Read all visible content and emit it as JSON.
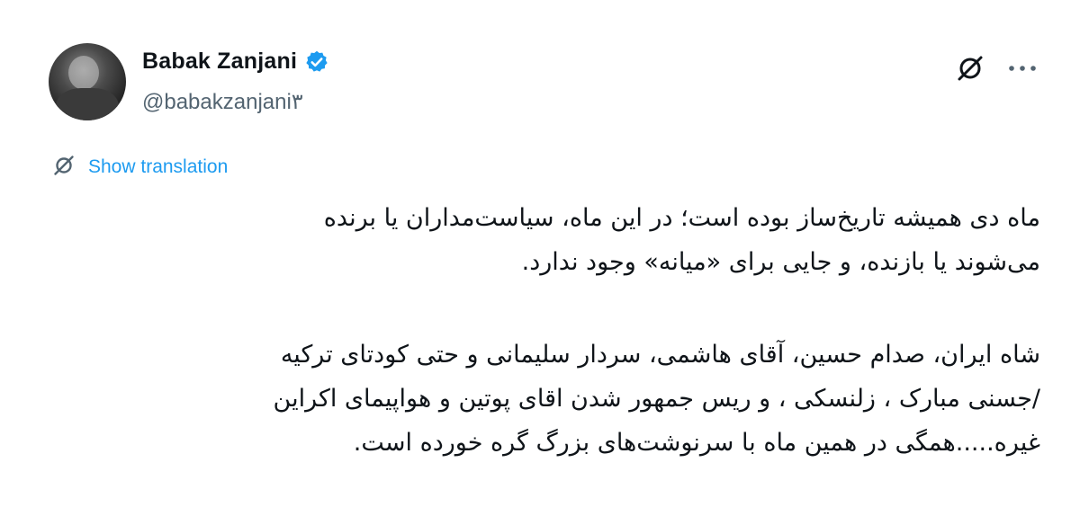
{
  "author": {
    "name": "Babak Zanjani",
    "handle": "@babakzanjani۳",
    "verified": true,
    "avatar_icon": "avatar-photo"
  },
  "actions": {
    "grok_icon": "grok-icon",
    "more_icon": "more-icon",
    "more_label": "···"
  },
  "translation": {
    "label": "Show translation",
    "icon": "translate-icon"
  },
  "tweet": {
    "paragraph1": [
      "ماه دی همیشه تاریخ‌ساز بوده است؛ در این ماه، سیاست‌مداران یا برنده",
      "می‌شوند یا بازنده، و جایی برای «میانه» وجود ندارد."
    ],
    "paragraph2": [
      "شاه ایران، صدام حسین، آقای هاشمی، سردار سلیمانی و حتی کودتای ترکیه",
      "/جسنی مبارک ، زلنسکی ، و ریس جمهور شدن اقای پوتین و هواپیمای اکراین",
      "غیره.....همگی در همین ماه با سرنوشت‌های بزرگ گره خورده است."
    ]
  },
  "colors": {
    "accent": "#1d9bf0",
    "secondary_text": "#536471",
    "primary_text": "#0f1419"
  }
}
